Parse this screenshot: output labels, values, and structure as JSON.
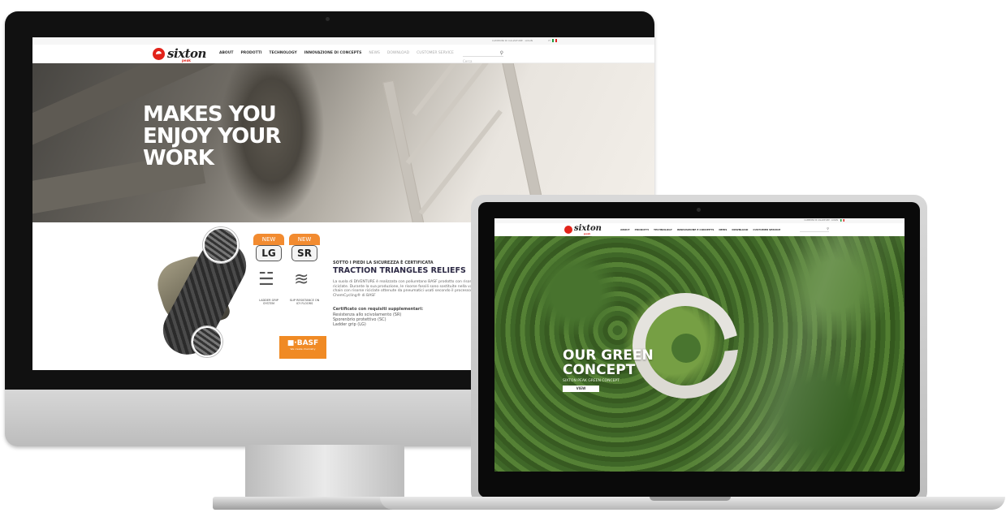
{
  "desktop_site": {
    "topbar": {
      "links": "CAMPIONI DI CALZATURE · LOGIN",
      "lang": "IT"
    },
    "logo": {
      "brand": "sixton",
      "tagline": "peak"
    },
    "menu": [
      "ABOUT",
      "PRODOTTI",
      "TECHNOLOGY",
      "INNOVAZIONE DI CONCEPTS",
      "NEWS",
      "DOWNLOAD",
      "CUSTOMER SERVICE"
    ],
    "search": {
      "placeholder": "Cerca",
      "icon": "search-icon"
    },
    "hero": {
      "title_line1": "MAKES YOU",
      "title_line2": "ENJOY YOUR",
      "title_line3": "WORK"
    },
    "product": {
      "badges": [
        {
          "new": "NEW",
          "code": "LG",
          "caption": "LADDER GRIP SYSTEM"
        },
        {
          "new": "NEW",
          "code": "SR",
          "caption": "SLIP RESISTANCE ON ICY FLOORS"
        }
      ],
      "kicker": "SOTTO I PIEDI LA SICUREZZA È CERTIFICATA",
      "title": "TRACTION TRIANGLES RELIEFS",
      "body": "La suola di DIVENTURE è realizzata con poliuretano BASF prodotto con risorse riciclate. Durante la sua produzione, le risorse fossili sono sostituite nella value chain con risorse riciclate ottenute da pneumatici usati secondo il processo ChemCycling® di BASF",
      "cert_title": "Certificato con requisiti supplementari:",
      "cert_items": [
        "Resistenza allo scivolamento (SR)",
        "Sporenbrio protettivo (SC)",
        "Ladder grip (LG)"
      ],
      "basf": {
        "logo": "■·BASF",
        "tagline": "We create chemistry"
      }
    }
  },
  "laptop_site": {
    "topbar": {
      "links": "CAMPIONI DI CALZATURE · LOGIN",
      "lang": "IT"
    },
    "logo": {
      "brand": "sixton",
      "tagline": "peak"
    },
    "menu": [
      "ABOUT",
      "PRODOTTI",
      "TECHNOLOGY",
      "INNOVAZIONE E CONCEPTS",
      "NEWS",
      "DOWNLOAD",
      "CUSTOMER SERVICE"
    ],
    "search": {
      "placeholder": "Cerca",
      "icon": "search-icon"
    },
    "hero": {
      "title_line1": "OUR GREEN",
      "title_line2": "CONCEPT",
      "subtitle": "SIXTON PEAK GREEN CONCEPT",
      "button": "VIEW"
    }
  },
  "colors": {
    "brand_red": "#e2231a",
    "badge_orange": "#f28b30",
    "basf_orange": "#f08a24",
    "forest_green": "#3f6e24"
  }
}
